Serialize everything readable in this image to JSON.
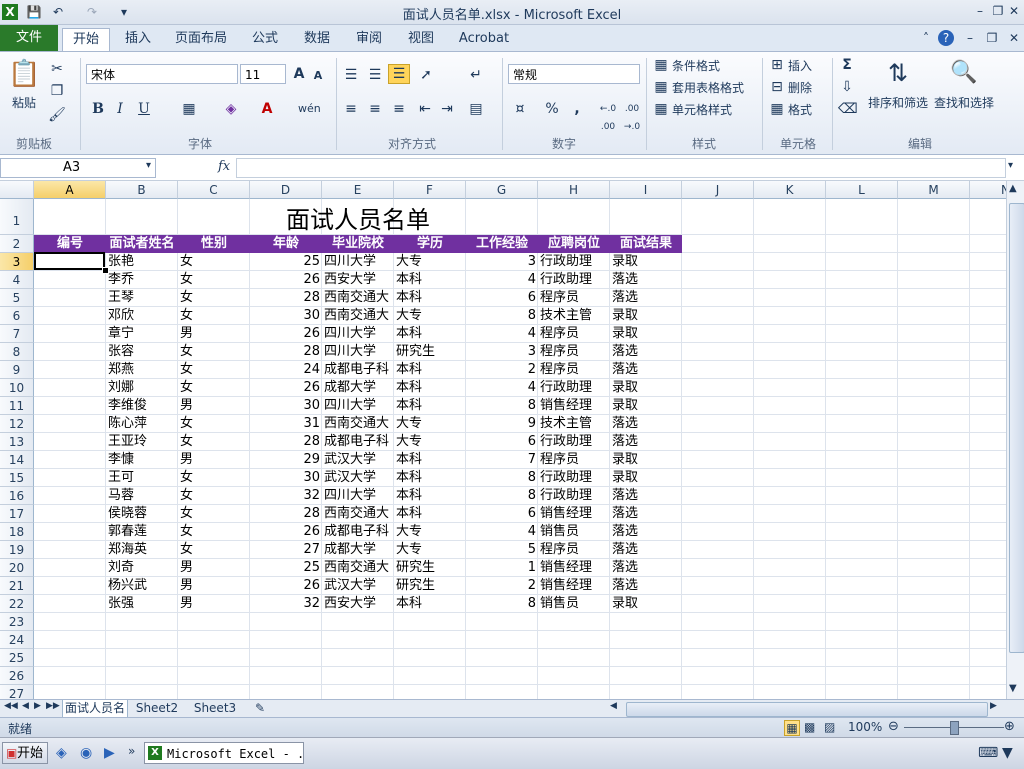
{
  "window": {
    "title": "面试人员名单.xlsx - Microsoft Excel"
  },
  "tabs": [
    "文件",
    "开始",
    "插入",
    "页面布局",
    "公式",
    "数据",
    "审阅",
    "视图",
    "Acrobat"
  ],
  "ribbon": {
    "clipboard": {
      "paste": "粘贴",
      "label": "剪贴板"
    },
    "font": {
      "name": "宋体",
      "size": "11",
      "label": "字体",
      "bold": "B",
      "italic": "I",
      "underline": "U"
    },
    "alignment": {
      "label": "对齐方式"
    },
    "number": {
      "format": "常规",
      "label": "数字",
      "percent": "%",
      "comma": ",",
      "inc_decimal": "←.0 .00",
      "dec_decimal": ".00 →.0"
    },
    "styles": {
      "conditional": "条件格式",
      "table": "套用表格格式",
      "cell_styles": "单元格样式",
      "label": "样式"
    },
    "cells": {
      "insert": "插入",
      "delete": "删除",
      "format": "格式",
      "label": "单元格"
    },
    "editing": {
      "sort": "排序和筛选",
      "find": "查找和选择",
      "label": "编辑",
      "sigma": "Σ"
    }
  },
  "formula_bar": {
    "name_box": "A3",
    "fx": "fx"
  },
  "columns": [
    "A",
    "B",
    "C",
    "D",
    "E",
    "F",
    "G",
    "H",
    "I",
    "J",
    "K",
    "L",
    "M",
    "N"
  ],
  "rows": [
    "1",
    "2",
    "3",
    "4",
    "5",
    "6",
    "7",
    "8",
    "9",
    "10",
    "11",
    "12",
    "13",
    "14",
    "15",
    "16",
    "17",
    "18",
    "19",
    "20",
    "21",
    "22",
    "23",
    "24",
    "25",
    "26",
    "27"
  ],
  "sheet": {
    "title": "面试人员名单",
    "headers": [
      "编号",
      "面试者姓名",
      "性别",
      "年龄",
      "毕业院校",
      "学历",
      "工作经验",
      "应聘岗位",
      "面试结果"
    ],
    "records": [
      [
        "张艳",
        "女",
        "25",
        "四川大学",
        "大专",
        "3",
        "行政助理",
        "录取"
      ],
      [
        "李乔",
        "女",
        "26",
        "西安大学",
        "本科",
        "4",
        "行政助理",
        "落选"
      ],
      [
        "王琴",
        "女",
        "28",
        "西南交通大",
        "本科",
        "6",
        "程序员",
        "落选"
      ],
      [
        "邓欣",
        "女",
        "30",
        "西南交通大",
        "大专",
        "8",
        "技术主管",
        "录取"
      ],
      [
        "章宁",
        "男",
        "26",
        "四川大学",
        "本科",
        "4",
        "程序员",
        "录取"
      ],
      [
        "张容",
        "女",
        "28",
        "四川大学",
        "研究生",
        "3",
        "程序员",
        "落选"
      ],
      [
        "郑燕",
        "女",
        "24",
        "成都电子科",
        "本科",
        "2",
        "程序员",
        "落选"
      ],
      [
        "刘娜",
        "女",
        "26",
        "成都大学",
        "本科",
        "4",
        "行政助理",
        "录取"
      ],
      [
        "李维俊",
        "男",
        "30",
        "四川大学",
        "本科",
        "8",
        "销售经理",
        "录取"
      ],
      [
        "陈心萍",
        "女",
        "31",
        "西南交通大",
        "大专",
        "9",
        "技术主管",
        "落选"
      ],
      [
        "王亚玲",
        "女",
        "28",
        "成都电子科",
        "大专",
        "6",
        "行政助理",
        "落选"
      ],
      [
        "李慷",
        "男",
        "29",
        "武汉大学",
        "本科",
        "7",
        "程序员",
        "录取"
      ],
      [
        "王可",
        "女",
        "30",
        "武汉大学",
        "本科",
        "8",
        "行政助理",
        "录取"
      ],
      [
        "马蓉",
        "女",
        "32",
        "四川大学",
        "本科",
        "8",
        "行政助理",
        "落选"
      ],
      [
        "侯晓蓉",
        "女",
        "28",
        "西南交通大",
        "本科",
        "6",
        "销售经理",
        "落选"
      ],
      [
        "郭春莲",
        "女",
        "26",
        "成都电子科",
        "大专",
        "4",
        "销售员",
        "落选"
      ],
      [
        "郑海英",
        "女",
        "27",
        "成都大学",
        "大专",
        "5",
        "程序员",
        "落选"
      ],
      [
        "刘奇",
        "男",
        "25",
        "西南交通大",
        "研究生",
        "1",
        "销售经理",
        "落选"
      ],
      [
        "杨兴武",
        "男",
        "26",
        "武汉大学",
        "研究生",
        "2",
        "销售经理",
        "落选"
      ],
      [
        "张强",
        "男",
        "32",
        "西安大学",
        "本科",
        "8",
        "销售员",
        "录取"
      ]
    ]
  },
  "sheet_tabs": [
    "面试人员名单",
    "Sheet2",
    "Sheet3"
  ],
  "status": {
    "ready": "就绪",
    "zoom": "100%"
  },
  "taskbar": {
    "start": "开始",
    "app": "Microsoft Excel - ..."
  },
  "colors": {
    "header_bg": "#7030a0",
    "file_tab": "#2a7a2a",
    "selection": "#000000"
  }
}
